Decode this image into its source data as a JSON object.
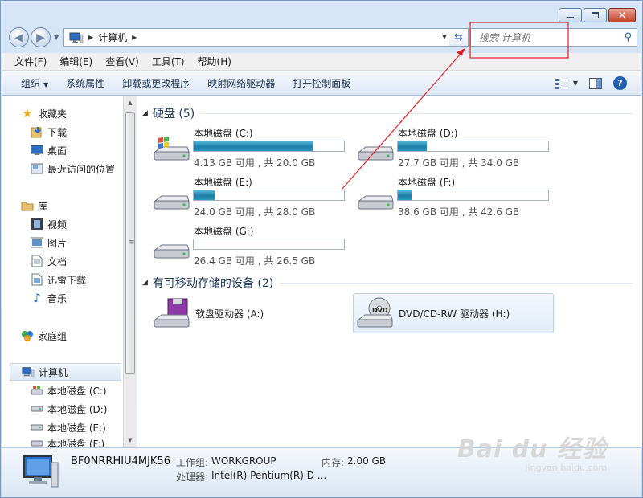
{
  "window": {
    "address": {
      "crumb": "计算机"
    },
    "search": {
      "placeholder": "搜索 计算机"
    }
  },
  "menu": [
    "文件(F)",
    "编辑(E)",
    "查看(V)",
    "工具(T)",
    "帮助(H)"
  ],
  "commands": {
    "organize": "组织",
    "items": [
      "系统属性",
      "卸载或更改程序",
      "映射网络驱动器",
      "打开控制面板"
    ]
  },
  "nav": {
    "favorites": "收藏夹",
    "favorites_items": [
      "下载",
      "桌面",
      "最近访问的位置"
    ],
    "libraries": "库",
    "libraries_items": [
      "视频",
      "图片",
      "文档",
      "迅雷下载",
      "音乐"
    ],
    "homegroup": "家庭组",
    "computer": "计算机",
    "computer_items": [
      "本地磁盘 (C:)",
      "本地磁盘 (D:)",
      "本地磁盘 (E:)",
      "本地磁盘 (F:)"
    ]
  },
  "hard_disks": {
    "title": "硬盘 (5)",
    "drives": [
      {
        "name": "本地磁盘 (C:)",
        "size": "4.13 GB 可用 , 共 20.0 GB",
        "used_fraction": 0.79
      },
      {
        "name": "本地磁盘 (D:)",
        "size": "27.7 GB 可用 , 共 34.0 GB",
        "used_fraction": 0.19
      },
      {
        "name": "本地磁盘 (E:)",
        "size": "24.0 GB 可用 , 共 28.0 GB",
        "used_fraction": 0.14
      },
      {
        "name": "本地磁盘 (F:)",
        "size": "38.6 GB 可用 , 共 42.6 GB",
        "used_fraction": 0.09
      },
      {
        "name": "本地磁盘 (G:)",
        "size": "26.4 GB 可用 , 共 26.5 GB",
        "used_fraction": 0.0
      }
    ]
  },
  "removable": {
    "title": "有可移动存储的设备 (2)",
    "items": [
      "软盘驱动器 (A:)",
      "DVD/CD-RW 驱动器 (H:)"
    ]
  },
  "status": {
    "computer_name": "BF0NRRHIU4MJK56",
    "workgroup_label": "工作组:",
    "workgroup_value": "WORKGROUP",
    "memory_label": "内存:",
    "memory_value": "2.00 GB",
    "cpu_label": "处理器:",
    "cpu_value": "Intel(R) Pentium(R) D ..."
  },
  "watermark": {
    "brand": "Bai du 经验",
    "url": "jingyan.baidu.com"
  },
  "colors": {
    "accent": "#2b97bd",
    "annotation": "#e0202a"
  }
}
